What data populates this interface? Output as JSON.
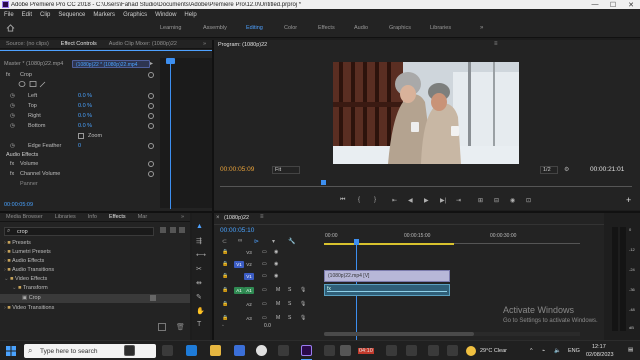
{
  "window": {
    "title": "Adobe Premiere Pro CC 2018 - C:\\Users\\Fahad Studio\\Documents\\Adobe\\Premiere Pro\\12.0\\Untitled.prproj *",
    "minimize": "—",
    "maximize": "☐",
    "close": "✕"
  },
  "menu": [
    "File",
    "Edit",
    "Clip",
    "Sequence",
    "Markers",
    "Graphics",
    "Window",
    "Help"
  ],
  "workspaces": {
    "tabs": [
      "Learning",
      "Assembly",
      "Editing",
      "Color",
      "Effects",
      "Audio",
      "Graphics",
      "Libraries"
    ],
    "active": "Editing",
    "more": "»"
  },
  "effect_controls": {
    "tabs": [
      "Source: (no clips)",
      "Effect Controls",
      "Audio Clip Mixer: (1080p)22"
    ],
    "menu_icon": "≡",
    "more": "»",
    "clip_path": "Master * (1080p)22.mp4",
    "clip_chip": "(1080p)22 * (1080p)22.mp4",
    "effect_name": "Crop",
    "fx": "fx",
    "params": [
      {
        "name": "Left",
        "value": "0.0 %"
      },
      {
        "name": "Top",
        "value": "0.0 %"
      },
      {
        "name": "Right",
        "value": "0.0 %"
      },
      {
        "name": "Bottom",
        "value": "0.0 %"
      }
    ],
    "zoom_label": "Zoom",
    "edge_feather": {
      "name": "Edge Feather",
      "value": "0"
    },
    "audio_effects": "Audio Effects",
    "audio_params": [
      "Volume",
      "Channel Volume",
      "Panner"
    ],
    "timecode": "00:00:05:09"
  },
  "program": {
    "title": "Program: (1080p)22",
    "menu_icon": "≡",
    "timecode": "00:00:05:09",
    "fit": "Fit",
    "resolution": "1/2",
    "duration": "00:00:21:01",
    "controls": [
      "⏮",
      "{",
      "}",
      "⇤",
      "◀",
      "▶",
      "▶|",
      "⇥",
      "⊞",
      "⊟",
      "◉",
      "⊡"
    ],
    "add": "+"
  },
  "project": {
    "tabs": [
      "Media Browser",
      "Libraries",
      "Info",
      "Effects",
      "Mar"
    ],
    "more": "»",
    "menu_icon": "≡",
    "search_value": "crop",
    "tree": [
      {
        "label": "Presets",
        "level": 0
      },
      {
        "label": "Lumetri Presets",
        "level": 0
      },
      {
        "label": "Audio Effects",
        "level": 0
      },
      {
        "label": "Audio Transitions",
        "level": 0
      },
      {
        "label": "Video Effects",
        "level": 0
      },
      {
        "label": "Transform",
        "level": 1
      },
      {
        "label": "Crop",
        "level": 2
      },
      {
        "label": "Video Transitions",
        "level": 0
      }
    ]
  },
  "timeline": {
    "close": "×",
    "title": "(1080p)22",
    "menu_icon": "≡",
    "timecode": "00:00:05:10",
    "ruler": [
      "00:00",
      "00:00:15:00",
      "00:00:30:00"
    ],
    "tracks": [
      {
        "id": "V3",
        "type": "video"
      },
      {
        "id": "V2",
        "type": "video"
      },
      {
        "id": "V1",
        "type": "video"
      },
      {
        "id": "A1",
        "type": "audio"
      },
      {
        "id": "A2",
        "type": "audio"
      },
      {
        "id": "A3",
        "type": "audio"
      }
    ],
    "mute": "M",
    "solo": "S",
    "video_clip": "(1080p)22.mp4 [V]",
    "audio_clip": "fx",
    "master": "0.0",
    "level_labels": [
      "0",
      "-12",
      "-24",
      "-36",
      "-48",
      "dB"
    ]
  },
  "activation": {
    "title": "Activate Windows",
    "subtitle": "Go to Settings to activate Windows."
  },
  "taskbar": {
    "search_placeholder": "Type here to search",
    "weather": "29°C  Clear",
    "time": "12:17",
    "date": "02/08/2023",
    "lang": "ENG",
    "badge": "04:10"
  },
  "colors": {
    "accent_blue": "#4ea1ff",
    "timecode_orange": "#e8a23a",
    "playhead_blue": "#3d8ff0",
    "video_track": "#5c6aa6",
    "audio_track": "#3a8a5a"
  }
}
